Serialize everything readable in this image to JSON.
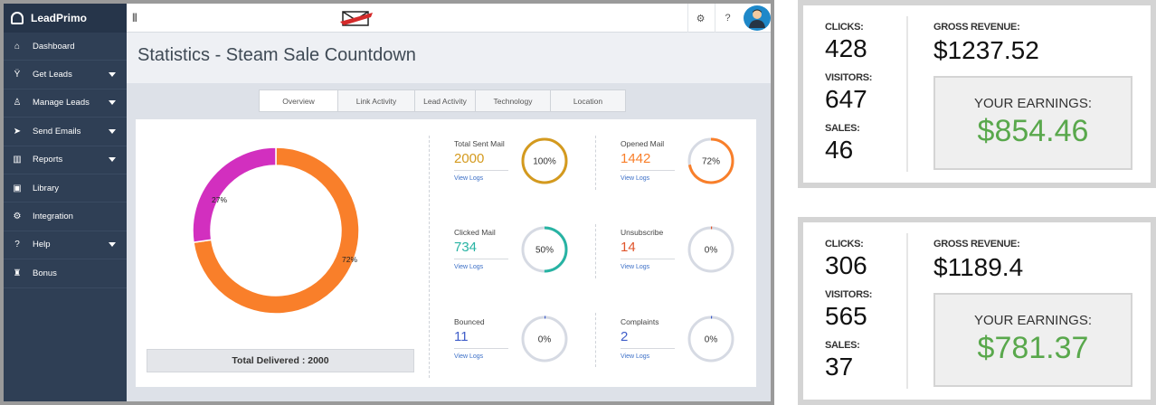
{
  "app": {
    "brand": "LeadPrimo",
    "page_title": "Statistics - Steam Sale Countdown",
    "colors": {
      "sidebar": "#2f3f55",
      "orange": "#f97f2a",
      "magenta": "#d22fbf",
      "gold": "#d49a1e",
      "teal": "#27b3a3",
      "blue": "#3f5dc9",
      "green": "#59a84c"
    }
  },
  "sidebar": {
    "items": [
      {
        "label": "Dashboard",
        "icon": "home-icon",
        "glyph": "⌂",
        "caret": false
      },
      {
        "label": "Get Leads",
        "icon": "funnel-icon",
        "glyph": "Ÿ",
        "caret": true
      },
      {
        "label": "Manage Leads",
        "icon": "people-icon",
        "glyph": "♙",
        "caret": true
      },
      {
        "label": "Send Emails",
        "icon": "paper-plane-icon",
        "glyph": "➤",
        "caret": true
      },
      {
        "label": "Reports",
        "icon": "bar-chart-icon",
        "glyph": "▥",
        "caret": true
      },
      {
        "label": "Library",
        "icon": "image-icon",
        "glyph": "▣",
        "caret": false
      },
      {
        "label": "Integration",
        "icon": "cogs-icon",
        "glyph": "⚙",
        "caret": false
      },
      {
        "label": "Help",
        "icon": "question-icon",
        "glyph": "?",
        "caret": true
      },
      {
        "label": "Bonus",
        "icon": "gift-icon",
        "glyph": "♜",
        "caret": false
      }
    ]
  },
  "topbar": {
    "settings_glyph": "⚙",
    "help_glyph": "?"
  },
  "tabs": [
    {
      "label": "Overview",
      "active": true
    },
    {
      "label": "Link Activity",
      "active": false
    },
    {
      "label": "Lead Activity",
      "active": false
    },
    {
      "label": "Technology",
      "active": false
    },
    {
      "label": "Location",
      "active": false
    }
  ],
  "donut": {
    "slices": [
      {
        "label": "72%",
        "value": 72,
        "color": "#f97f2a"
      },
      {
        "label": "27%",
        "value": 27,
        "color": "#d22fbf"
      }
    ],
    "total_label": "Total Delivered : 2000"
  },
  "stats": [
    {
      "label": "Total Sent Mail",
      "value": "2000",
      "link": "View Logs",
      "percent_label": "100%",
      "percent": 1.0,
      "color": "#d49a1e"
    },
    {
      "label": "Opened Mail",
      "value": "1442",
      "link": "View Logs",
      "percent_label": "72%",
      "percent": 0.72,
      "color": "#f97f2a"
    },
    {
      "label": "Clicked Mail",
      "value": "734",
      "link": "View Logs",
      "percent_label": "50%",
      "percent": 0.5,
      "color": "#27b3a3"
    },
    {
      "label": "Unsubscribe",
      "value": "14",
      "link": "View Logs",
      "percent_label": "0%",
      "percent": 0.007,
      "color": "#e0552b"
    },
    {
      "label": "Bounced",
      "value": "11",
      "link": "View Logs",
      "percent_label": "0%",
      "percent": 0.005,
      "color": "#3f5dc9"
    },
    {
      "label": "Complaints",
      "value": "2",
      "link": "View Logs",
      "percent_label": "0%",
      "percent": 0.002,
      "color": "#3f5dc9"
    }
  ],
  "cards": [
    {
      "clicks_label": "CLICKS:",
      "clicks": "428",
      "visitors_label": "VISITORS:",
      "visitors": "647",
      "sales_label": "SALES:",
      "sales": "46",
      "gross_label": "GROSS REVENUE:",
      "gross": "$1237.52",
      "earnings_label": "YOUR EARNINGS:",
      "earnings": "$854.46"
    },
    {
      "clicks_label": "CLICKS:",
      "clicks": "306",
      "visitors_label": "VISITORS:",
      "visitors": "565",
      "sales_label": "SALES:",
      "sales": "37",
      "gross_label": "GROSS REVENUE:",
      "gross": "$1189.4",
      "earnings_label": "YOUR EARNINGS:",
      "earnings": "$781.37"
    }
  ]
}
